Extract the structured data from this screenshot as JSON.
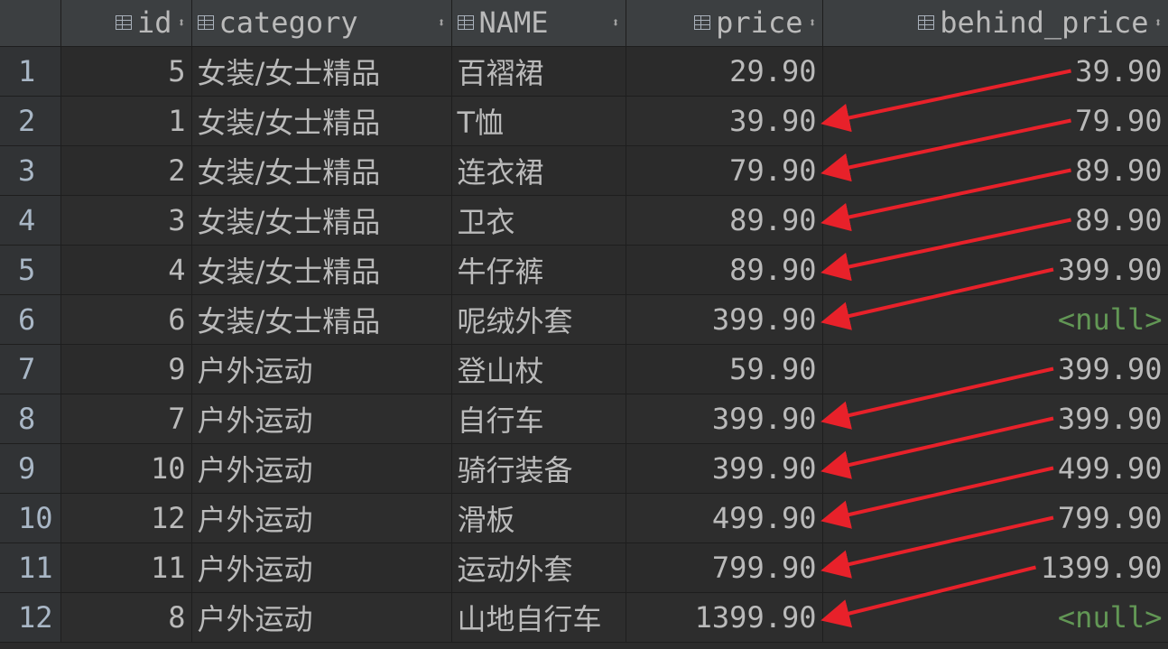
{
  "columns": [
    {
      "key": "rownum",
      "label": ""
    },
    {
      "key": "id",
      "label": "id"
    },
    {
      "key": "category",
      "label": "category"
    },
    {
      "key": "NAME",
      "label": "NAME"
    },
    {
      "key": "price",
      "label": "price"
    },
    {
      "key": "behind_price",
      "label": "behind_price"
    }
  ],
  "rows": [
    {
      "rownum": "1",
      "id": "5",
      "category": "女装/女士精品",
      "NAME": "百褶裙",
      "price": "29.90",
      "behind_price": "39.90"
    },
    {
      "rownum": "2",
      "id": "1",
      "category": "女装/女士精品",
      "NAME": "T恤",
      "price": "39.90",
      "behind_price": "79.90"
    },
    {
      "rownum": "3",
      "id": "2",
      "category": "女装/女士精品",
      "NAME": "连衣裙",
      "price": "79.90",
      "behind_price": "89.90"
    },
    {
      "rownum": "4",
      "id": "3",
      "category": "女装/女士精品",
      "NAME": "卫衣",
      "price": "89.90",
      "behind_price": "89.90"
    },
    {
      "rownum": "5",
      "id": "4",
      "category": "女装/女士精品",
      "NAME": "牛仔裤",
      "price": "89.90",
      "behind_price": "399.90"
    },
    {
      "rownum": "6",
      "id": "6",
      "category": "女装/女士精品",
      "NAME": "呢绒外套",
      "price": "399.90",
      "behind_price": "<null>"
    },
    {
      "rownum": "7",
      "id": "9",
      "category": "户外运动",
      "NAME": "登山杖",
      "price": "59.90",
      "behind_price": "399.90"
    },
    {
      "rownum": "8",
      "id": "7",
      "category": "户外运动",
      "NAME": "自行车",
      "price": "399.90",
      "behind_price": "399.90"
    },
    {
      "rownum": "9",
      "id": "10",
      "category": "户外运动",
      "NAME": "骑行装备",
      "price": "399.90",
      "behind_price": "499.90"
    },
    {
      "rownum": "10",
      "id": "12",
      "category": "户外运动",
      "NAME": "滑板",
      "price": "499.90",
      "behind_price": "799.90"
    },
    {
      "rownum": "11",
      "id": "11",
      "category": "户外运动",
      "NAME": "运动外套",
      "price": "799.90",
      "behind_price": "1399.90"
    },
    {
      "rownum": "12",
      "id": "8",
      "category": "户外运动",
      "NAME": "山地自行车",
      "price": "1399.90",
      "behind_price": "<null>"
    }
  ],
  "annotations": {
    "arrow_color": "#e8212a",
    "arrow_meaning": "behind_price of row N points to price of row N+1",
    "arrows": [
      {
        "from_row": 1,
        "to_row": 2
      },
      {
        "from_row": 2,
        "to_row": 3
      },
      {
        "from_row": 3,
        "to_row": 4
      },
      {
        "from_row": 4,
        "to_row": 5
      },
      {
        "from_row": 5,
        "to_row": 6
      },
      {
        "from_row": 7,
        "to_row": 8
      },
      {
        "from_row": 8,
        "to_row": 9
      },
      {
        "from_row": 9,
        "to_row": 10
      },
      {
        "from_row": 10,
        "to_row": 11
      },
      {
        "from_row": 11,
        "to_row": 12
      }
    ]
  },
  "colors": {
    "null_text": "#629755",
    "header_bg": "#3c3f41",
    "rownum_bg": "#313335",
    "cell_bg": "#2b2b2b"
  }
}
